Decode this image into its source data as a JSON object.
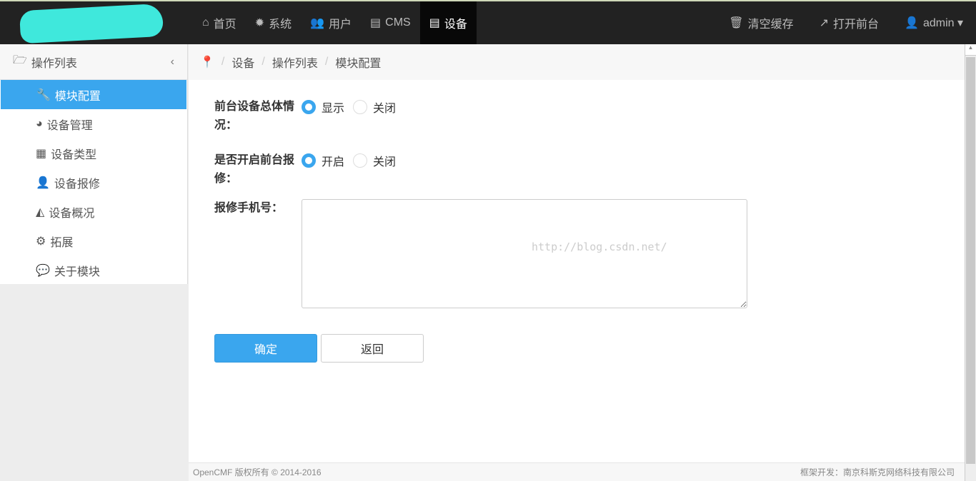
{
  "topnav": {
    "items": [
      {
        "icon": "home-icon",
        "glyph": "⌂",
        "label": "首页"
      },
      {
        "icon": "gear-icon",
        "glyph": "✹",
        "label": "系统"
      },
      {
        "icon": "users-icon",
        "glyph": "👥",
        "label": "用户"
      },
      {
        "icon": "newspaper-icon",
        "glyph": "▤",
        "label": "CMS"
      },
      {
        "icon": "newspaper-icon",
        "glyph": "▤",
        "label": "设备",
        "active": true
      }
    ],
    "right": [
      {
        "icon": "trash-icon",
        "glyph": "🗑",
        "label": "清空缓存"
      },
      {
        "icon": "external-link-icon",
        "glyph": "↗",
        "label": "打开前台"
      },
      {
        "icon": "user-icon",
        "glyph": "👤",
        "label": "admin ▾"
      }
    ]
  },
  "sidebar": {
    "title": "操作列表",
    "title_glyph": "🗁",
    "collapse": "‹",
    "items": [
      {
        "icon": "wrench-icon",
        "glyph": "🔧",
        "label": "模块配置",
        "active": true
      },
      {
        "icon": "dashboard-icon",
        "glyph": "◕",
        "label": "设备管理"
      },
      {
        "icon": "grid-icon",
        "glyph": "▦",
        "label": "设备类型"
      },
      {
        "icon": "user-icon",
        "glyph": "👤",
        "label": "设备报修"
      },
      {
        "icon": "area-chart-icon",
        "glyph": "◭",
        "label": "设备概况"
      },
      {
        "icon": "gears-icon",
        "glyph": "⚙",
        "label": "拓展"
      },
      {
        "icon": "comment-icon",
        "glyph": "💬",
        "label": "关于模块"
      }
    ]
  },
  "breadcrumb": {
    "icon": "map-marker-icon",
    "glyph": "📍",
    "items": [
      "设备",
      "操作列表",
      "模块配置"
    ]
  },
  "form": {
    "overview": {
      "label": "前台设备总体情况：",
      "options": [
        "显示",
        "关闭"
      ],
      "selected": "显示"
    },
    "repair": {
      "label": "是否开启前台报修：",
      "options": [
        "开启",
        "关闭"
      ],
      "selected": "开启"
    },
    "phone": {
      "label": "报修手机号：",
      "value": "",
      "watermark": "http://blog.csdn.net/"
    },
    "submit": "确定",
    "back": "返回"
  },
  "footer": {
    "left": "OpenCMF  版权所有 © 2014-2016",
    "right": "框架开发：南京科斯克网络科技有限公司"
  }
}
